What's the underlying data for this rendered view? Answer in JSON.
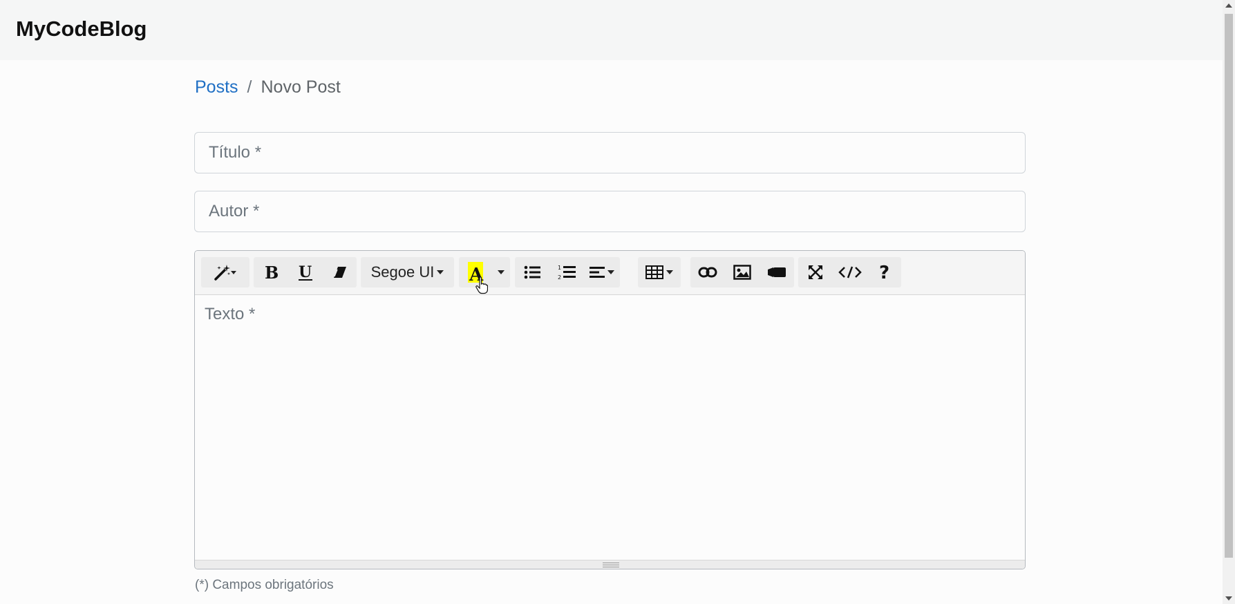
{
  "navbar": {
    "brand": "MyCodeBlog"
  },
  "breadcrumb": {
    "link": "Posts",
    "separator": "/",
    "current": "Novo Post"
  },
  "form": {
    "title_placeholder": "Título *",
    "author_placeholder": "Autor *",
    "text_placeholder": "Texto *",
    "required_note": "(*) Campos obrigatórios"
  },
  "toolbar": {
    "font_family": "Segoe UI",
    "highlight_color": "#ffff00",
    "buttons": [
      "style-icon",
      "bold-icon",
      "underline-icon",
      "eraser-icon",
      "font-family-dropdown",
      "text-color-icon",
      "unordered-list-icon",
      "ordered-list-icon",
      "align-icon",
      "table-icon",
      "link-icon",
      "picture-icon",
      "video-icon",
      "fullscreen-icon",
      "code-view-icon",
      "help-icon"
    ]
  },
  "colors": {
    "link": "#1f6fc4",
    "muted": "#6c757d"
  }
}
